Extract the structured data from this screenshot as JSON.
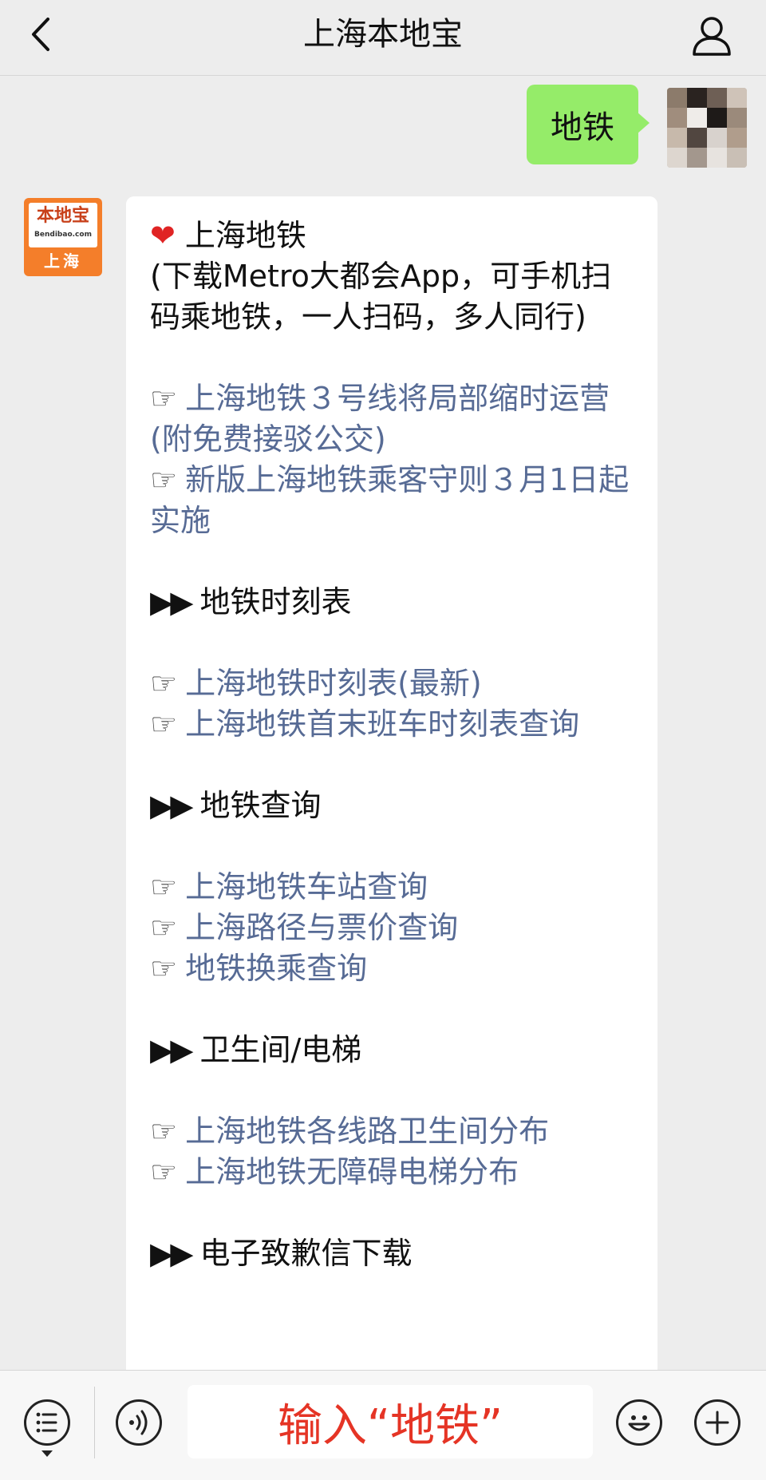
{
  "header": {
    "title": "上海本地宝"
  },
  "user_message": {
    "text": "地铁"
  },
  "bot": {
    "avatar": {
      "brand": "本地宝",
      "url": "Bendibao.com",
      "city": "上海"
    },
    "intro_title": "上海地铁",
    "intro_desc": "(下载Metro大都会App，可手机扫码乘地铁，一人扫码，多人同行)",
    "links_top": [
      "上海地铁３号线将局部缩时运营(附免费接驳公交)",
      "新版上海地铁乘客守则３月1日起实施"
    ],
    "sections": [
      {
        "heading": "地铁时刻表",
        "links": [
          "上海地铁时刻表(最新)",
          "上海地铁首末班车时刻表查询"
        ]
      },
      {
        "heading": "地铁查询",
        "links": [
          "上海地铁车站查询",
          "上海路径与票价查询",
          "地铁换乘查询"
        ]
      },
      {
        "heading": "卫生间/电梯",
        "links": [
          "上海地铁各线路卫生间分布",
          "上海地铁无障碍电梯分布"
        ]
      },
      {
        "heading": "电子致歉信下载",
        "links": []
      }
    ],
    "hand_glyph": "☞",
    "arrow_glyph": "▶▶",
    "heart_glyph": "❤"
  },
  "input": {
    "text": "输入“地铁”"
  },
  "icons": {
    "back": "chevron-left-icon",
    "profile": "person-icon",
    "menu": "list-menu-icon",
    "voice": "voice-icon",
    "emoji": "smiley-icon",
    "plus": "plus-icon"
  },
  "colors": {
    "user_bubble": "#95ec69",
    "link": "#576b95",
    "brand_orange": "#f47e2a",
    "input_text": "#e53425"
  }
}
